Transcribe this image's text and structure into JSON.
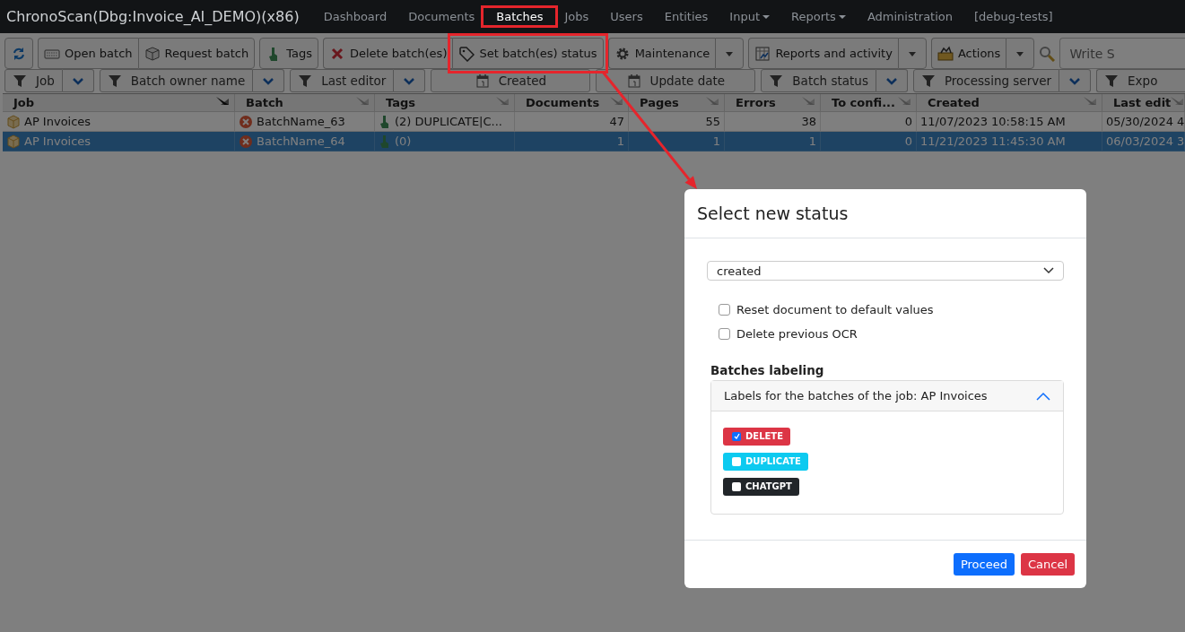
{
  "app_title": "ChronoScan(Dbg:Invoice_AI_DEMO)(x86)",
  "nav": [
    {
      "label": "Dashboard",
      "selected": false,
      "has_menu": false,
      "highlighted": false
    },
    {
      "label": "Documents",
      "selected": false,
      "has_menu": false,
      "highlighted": false
    },
    {
      "label": "Batches",
      "selected": true,
      "has_menu": false,
      "highlighted": true
    },
    {
      "label": "Jobs",
      "selected": false,
      "has_menu": false,
      "highlighted": false
    },
    {
      "label": "Users",
      "selected": false,
      "has_menu": false,
      "highlighted": false
    },
    {
      "label": "Entities",
      "selected": false,
      "has_menu": false,
      "highlighted": false
    },
    {
      "label": "Input",
      "selected": false,
      "has_menu": true,
      "highlighted": false
    },
    {
      "label": "Reports",
      "selected": false,
      "has_menu": true,
      "highlighted": false
    },
    {
      "label": "Administration",
      "selected": false,
      "has_menu": false,
      "highlighted": false
    },
    {
      "label": "[debug-tests]",
      "selected": false,
      "has_menu": false,
      "highlighted": false
    }
  ],
  "toolbar": {
    "buttons": [
      {
        "label": "Open batch",
        "kind": "button",
        "highlighted": false
      },
      {
        "label": "Request batch",
        "kind": "joined",
        "highlighted": false
      },
      {
        "label": "Tags",
        "kind": "button",
        "highlighted": false
      },
      {
        "label": "Delete batch(es)",
        "kind": "button",
        "highlighted": false
      },
      {
        "label": "Set batch(es) status",
        "kind": "joined",
        "highlighted": true
      },
      {
        "label": "Maintenance",
        "kind": "split",
        "highlighted": false
      },
      {
        "label": "Reports and activity",
        "kind": "split",
        "highlighted": false
      },
      {
        "label": "Actions",
        "kind": "split",
        "highlighted": false
      }
    ],
    "search": {
      "placeholder": "Write S"
    }
  },
  "filters": [
    {
      "label": "Job",
      "kind": "filter",
      "dropdown": true
    },
    {
      "label": "Batch owner name",
      "kind": "filter",
      "dropdown": true
    },
    {
      "label": "Last editor",
      "kind": "filter",
      "dropdown": true
    },
    {
      "label": "Created",
      "kind": "date",
      "dropdown": false
    },
    {
      "label": "Update date",
      "kind": "date",
      "dropdown": false
    },
    {
      "label": "Batch status",
      "kind": "filter",
      "dropdown": true
    },
    {
      "label": "Processing server",
      "kind": "filter",
      "dropdown": true
    },
    {
      "label": "Expo",
      "kind": "filter",
      "dropdown": false
    }
  ],
  "table": {
    "columns": [
      {
        "label": "Job",
        "kind": "job",
        "sorted": true
      },
      {
        "label": "Batch",
        "kind": "batch",
        "sorted": false
      },
      {
        "label": "Tags",
        "kind": "tags",
        "sorted": false
      },
      {
        "label": "Documents",
        "kind": "number",
        "sorted": false
      },
      {
        "label": "Pages",
        "kind": "number",
        "sorted": false
      },
      {
        "label": "Errors",
        "kind": "number",
        "sorted": false
      },
      {
        "label": "To confi...",
        "kind": "number",
        "sorted": false
      },
      {
        "label": "Created",
        "kind": "date",
        "sorted": false
      },
      {
        "label": "Last edit",
        "kind": "date",
        "sorted": false
      }
    ],
    "rows": [
      {
        "selected": false,
        "cells": [
          "AP Invoices",
          "BatchName_63",
          "(2) DUPLICATE|C...",
          "47",
          "55",
          "38",
          "0",
          "11/07/2023 10:58:15 AM",
          "05/30/2024 4"
        ]
      },
      {
        "selected": true,
        "cells": [
          "AP Invoices",
          "BatchName_64",
          "(0)",
          "1",
          "1",
          "1",
          "0",
          "11/21/2023 11:45:30 AM",
          "06/03/2024 3"
        ]
      }
    ]
  },
  "modal": {
    "title": "Select new status",
    "status_select": {
      "value": "created"
    },
    "options": [
      {
        "label": "Reset document to default values",
        "checked": false
      },
      {
        "label": "Delete previous OCR",
        "checked": false
      }
    ],
    "labeling": {
      "title": "Batches labeling",
      "accordion": {
        "header": "Labels for the batches of the job: AP Invoices",
        "expanded": true
      },
      "labels": [
        {
          "text": "DELETE",
          "color": "#dc3545",
          "checked": true
        },
        {
          "text": "DUPLICATE",
          "color": "#0dcaf0",
          "checked": false
        },
        {
          "text": "CHATGPT",
          "color": "#212529",
          "checked": false
        }
      ]
    },
    "buttons": [
      {
        "label": "Proceed",
        "kind": "primary"
      },
      {
        "label": "Cancel",
        "kind": "danger"
      }
    ]
  }
}
